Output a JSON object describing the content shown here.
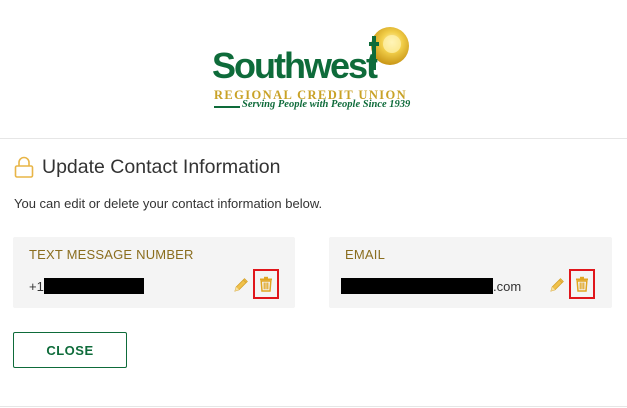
{
  "logo": {
    "name": "Southwest",
    "subtitle": "REGIONAL CREDIT UNION",
    "tagline": "Serving People with People Since 1939"
  },
  "page": {
    "title": "Update Contact Information",
    "intro": "You can edit or delete your contact information below."
  },
  "cards": {
    "text": {
      "label": "TEXT MESSAGE NUMBER",
      "value_prefix": "+1",
      "edit_icon": "pencil-icon",
      "delete_icon": "trash-icon"
    },
    "email": {
      "label": "EMAIL",
      "value_suffix": ".com",
      "edit_icon": "pencil-icon",
      "delete_icon": "trash-icon"
    }
  },
  "actions": {
    "close_label": "CLOSE"
  },
  "colors": {
    "brand_green": "#0e6b3a",
    "brand_gold": "#c9a227",
    "label_gold": "#8a6d1e",
    "highlight_red": "#e0161b",
    "card_bg": "#f4f4f4"
  }
}
